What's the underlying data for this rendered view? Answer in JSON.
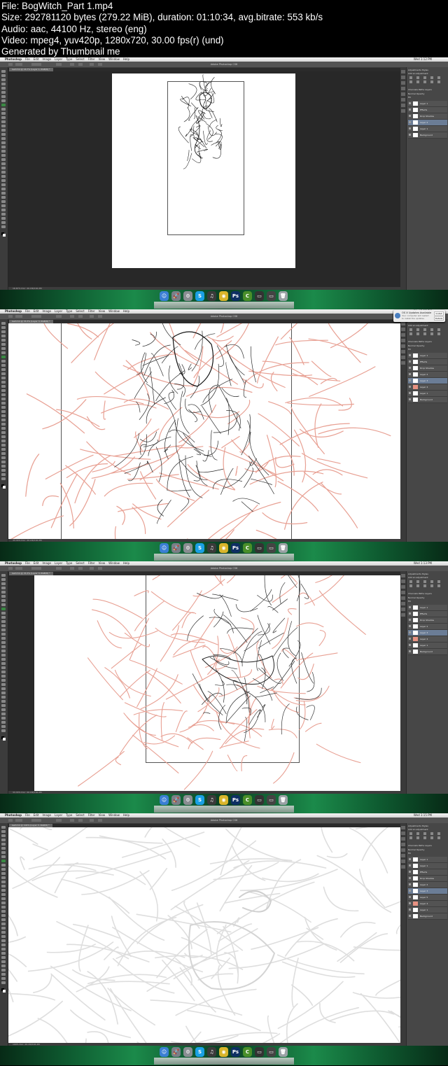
{
  "file_info": {
    "line1": "File: BogWitch_Part 1.mp4",
    "line2": "Size: 292781120 bytes (279.22 MiB), duration: 01:10:34, avg.bitrate: 553 kb/s",
    "line3": "Audio: aac, 44100 Hz, stereo (eng)",
    "line4": "Video: mpeg4, yuv420p, 1280x720, 30.00 fps(r) (und)",
    "line5": "Generated by Thumbnail me"
  },
  "app": {
    "menu": [
      "Photoshop",
      "File",
      "Edit",
      "Image",
      "Layer",
      "Type",
      "Select",
      "Filter",
      "View",
      "Window",
      "Help"
    ],
    "window_title": "Adobe Photoshop CS6",
    "panel_tabs": [
      "Adjustments",
      "Styles"
    ],
    "add_adjustment": "Add an adjustment",
    "layers_tabs": [
      "Channels",
      "Paths",
      "Layers"
    ],
    "blend_mode": "Normal",
    "opacity_label": "Opacity",
    "fill_label": "Fill",
    "effects_label": "Effects",
    "drop_shadow_label": "Drop Shadow"
  },
  "frames": [
    {
      "clock": "Wed 1:12 PM",
      "doc_tab": "bwitch4 @ 16.7% (Layer 1, RGB/8) *",
      "status": "16.67%  Doc: 20.1M/116.2M",
      "layers": [
        "Layer 1",
        "Effects",
        "Drop Shadow",
        "Layer 2",
        "Layer 1",
        "Background"
      ],
      "selected_layer": 3,
      "pink_layers": []
    },
    {
      "clock": "Wed 1:13 PM",
      "doc_tab": "bwitch4 @ 33.3% (Layer 3, RGB/8) *",
      "status": "33.33%  Doc: 20.1M/116.2M",
      "layers": [
        "Layer 1",
        "Effects",
        "Drop Shadow",
        "Layer 2",
        "Layer 3",
        "Layer 4",
        "Layer 1",
        "Background"
      ],
      "selected_layer": 4,
      "pink_layers": [
        5
      ],
      "notification": {
        "title": "OS X Updates Available",
        "text": "Your computer will restart to install the updates",
        "button1": "Install",
        "button2": "Details"
      }
    },
    {
      "clock": "Wed 1:13 PM",
      "doc_tab": "bwitch4 @ 33.3% (Layer 3, RGB/8) *",
      "status": "33.33%  Doc: 20.1M/116.2M",
      "layers": [
        "Layer 1",
        "Effects",
        "Drop Shadow",
        "Layer 2",
        "Layer 3",
        "Layer 4",
        "Layer 1",
        "Background"
      ],
      "selected_layer": 4,
      "pink_layers": [
        5
      ]
    },
    {
      "clock": "Wed 1:15 PM",
      "doc_tab": "bwitch4 @ 100% (Layer 3, RGB/8) *",
      "status": "100%  Doc: 20.1M/116.2M",
      "layers": [
        "Layer 1",
        "Layer 1",
        "Effects",
        "Drop Shadow",
        "Layer 2",
        "Layer 3",
        "Layer 5",
        "Layer 4",
        "Layer 1",
        "Background"
      ],
      "selected_layer": 5,
      "pink_layers": [
        7
      ]
    }
  ],
  "dock_icons": [
    {
      "name": "finder-icon",
      "color": "#3b7fd4",
      "glyph": "☺"
    },
    {
      "name": "launchpad-icon",
      "color": "#7a7f88",
      "glyph": "🚀"
    },
    {
      "name": "system-prefs-icon",
      "color": "#8a8d92",
      "glyph": "⚙"
    },
    {
      "name": "skype-icon",
      "color": "#1aa0e4",
      "glyph": "S"
    },
    {
      "name": "spotify-icon",
      "color": "#3a3a3a",
      "glyph": "♫"
    },
    {
      "name": "chrome-icon",
      "color": "#d9b52a",
      "glyph": "◉"
    },
    {
      "name": "photoshop-icon",
      "color": "#0e2f63",
      "glyph": "Ps"
    },
    {
      "name": "camtasia-icon",
      "color": "#4a8f2a",
      "glyph": "C"
    },
    {
      "name": "folder-icon",
      "color": "#333333",
      "glyph": "▭"
    },
    {
      "name": "folder-2-icon",
      "color": "#444444",
      "glyph": "▭"
    },
    {
      "name": "trash-icon",
      "color": "#9ba2a6",
      "glyph": "🗑"
    }
  ]
}
